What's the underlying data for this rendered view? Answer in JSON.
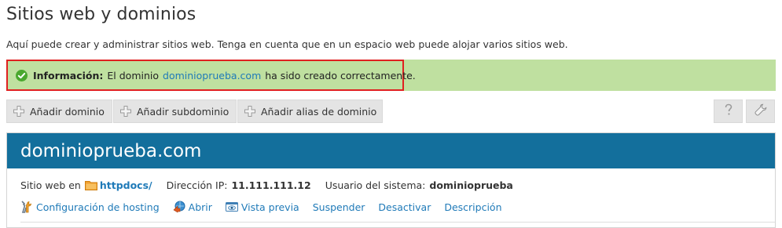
{
  "page": {
    "title": "Sitios web y dominios",
    "description": "Aquí puede crear y administrar sitios web. Tenga en cuenta que en un espacio web puede alojar varios sitios web."
  },
  "message": {
    "label": "Información:",
    "text_before": "El dominio",
    "link": "dominioprueba.com",
    "text_after": "ha sido creado correctamente.",
    "icon": "check-circle-icon",
    "background": "#bfe0a0",
    "highlight": "#e02020"
  },
  "toolbar": {
    "add_domain": "Añadir dominio",
    "add_subdomain": "Añadir subdominio",
    "add_alias": "Añadir alias de dominio",
    "help_icon": "question-icon",
    "tools_icon": "wrench-icon"
  },
  "domain": {
    "name": "dominioprueba.com",
    "header_color": "#136f9c",
    "website_at_label": "Sitio web en",
    "docroot": "httpdocs/",
    "ip_label": "Dirección IP:",
    "ip_value": "11.111.111.12",
    "user_label": "Usuario del sistema:",
    "user_value": "dominioprueba",
    "actions": {
      "hosting": "Configuración de hosting",
      "open": "Abrir",
      "preview": "Vista previa",
      "suspend": "Suspender",
      "deactivate": "Desactivar",
      "description": "Descripción"
    }
  }
}
